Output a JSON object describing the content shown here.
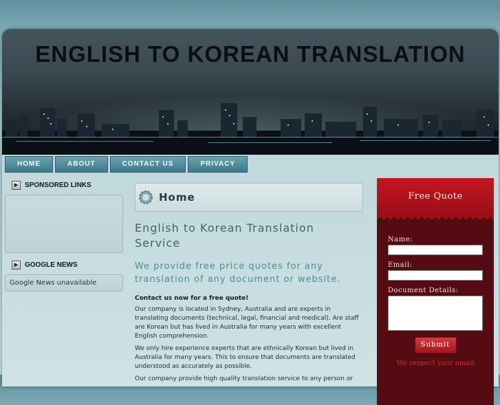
{
  "header": {
    "title": "ENGLISH TO KOREAN TRANSLATION"
  },
  "nav": [
    "HOME",
    "ABOUT",
    "CONTACT US",
    "PRIVACY"
  ],
  "sidebar": {
    "sponsored_title": "SPONSORED LINKS",
    "news_title": "GOOGLE NEWS",
    "news_text": "Google News unavailable"
  },
  "main": {
    "page_title": "Home",
    "heading": "English to Korean Translation Service",
    "subheading": "We provide free price quotes for any translation of any document or website.",
    "contact_line": "Contact us now for a free quote!",
    "paragraphs": [
      "Our company is located in Sydney, Australia and are experts in translating documents (technical, legal, financial and medical). Are staff are Korean but has lived in Australia for many years with excellent English comprehension.",
      "We only hire experience experts that are ethnically Korean but lived in Australia for many years. This to ensure that documents are translated understood as accurately as possible.",
      "Our company provide high quality translation service to any person or"
    ]
  },
  "quote": {
    "title": "Free Quote",
    "name_label": "Name:",
    "email_label": "Email:",
    "details_label": "Document Details:",
    "submit_label": "Submit",
    "footer_text": "We respect your email"
  }
}
